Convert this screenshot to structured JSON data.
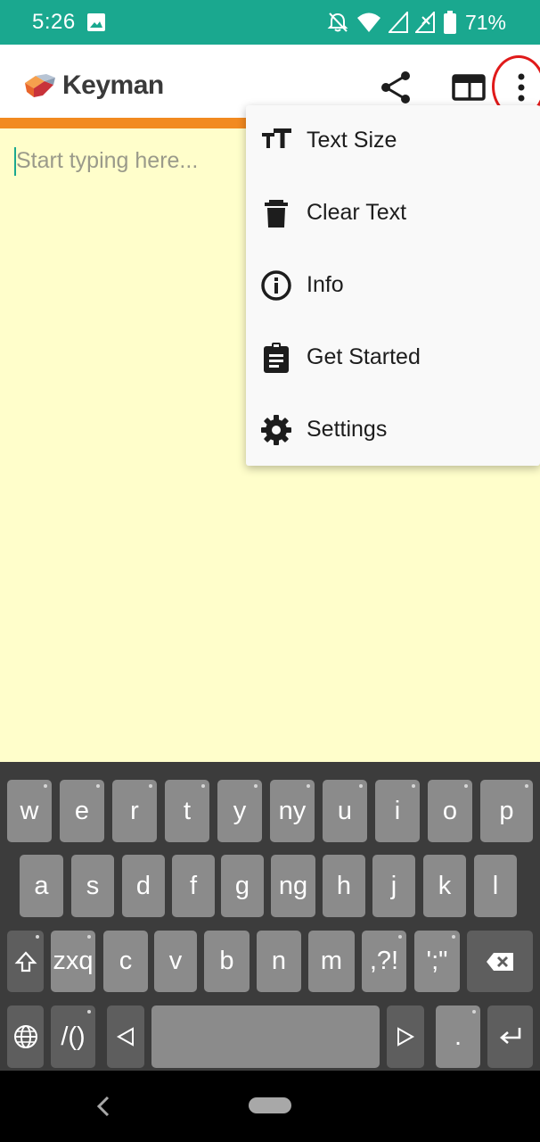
{
  "status_bar": {
    "time": "5:26",
    "battery_percent": "71%",
    "icons": [
      "image-icon",
      "alarm-off-icon",
      "wifi-icon",
      "signal-icon",
      "signal-x-icon",
      "battery-icon"
    ]
  },
  "app_bar": {
    "title": "Keyman",
    "actions": [
      "share-icon",
      "layout-icon",
      "more-vert-icon"
    ],
    "highlight_color": "#e01a1a"
  },
  "editor": {
    "placeholder": "Start typing here..."
  },
  "menu": {
    "items": [
      {
        "label": "Text Size",
        "icon": "text-size-icon"
      },
      {
        "label": "Clear Text",
        "icon": "trash-icon"
      },
      {
        "label": "Info",
        "icon": "info-icon"
      },
      {
        "label": "Get Started",
        "icon": "clipboard-icon"
      },
      {
        "label": "Settings",
        "icon": "gear-icon"
      }
    ]
  },
  "keyboard": {
    "row1": [
      "w",
      "e",
      "r",
      "t",
      "y",
      "ny",
      "u",
      "i",
      "o",
      "p"
    ],
    "row2": [
      "a",
      "s",
      "d",
      "f",
      "g",
      "ng",
      "h",
      "j",
      "k",
      "l"
    ],
    "row3": [
      "zxq",
      "c",
      "v",
      "b",
      "n",
      "m",
      ",?!",
      "';\""
    ],
    "row4": {
      "symbols": "/()",
      "period": "."
    },
    "special_icons": [
      "shift-icon",
      "backspace-icon",
      "globe-icon",
      "left-arrow-icon",
      "right-arrow-icon",
      "enter-icon"
    ]
  },
  "colors": {
    "status_bar": "#1aa88f",
    "accent_line": "#f28a20",
    "editor_background": "#fffecb",
    "keyboard_background": "#3c3c3c",
    "key": "#8b8b8b",
    "key_dark": "#5e5e5e"
  }
}
